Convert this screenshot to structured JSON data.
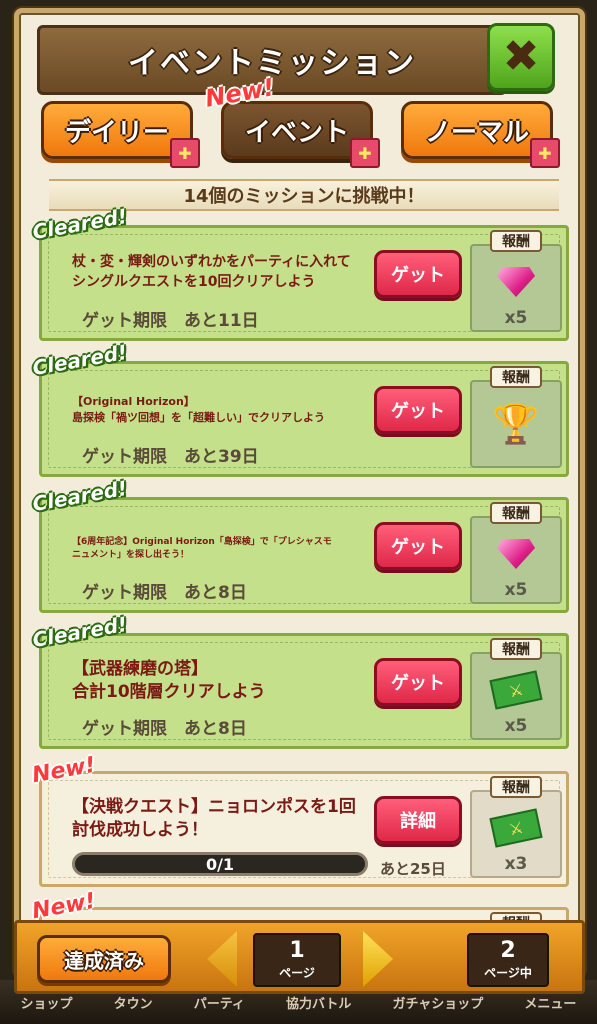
{
  "header": {
    "title": "イベントミッション",
    "close_icon": "close-x-icon"
  },
  "tabs": [
    {
      "label": "デイリー",
      "style": "orange"
    },
    {
      "label": "イベント",
      "style": "brown",
      "badge": "New!"
    },
    {
      "label": "ノーマル",
      "style": "orange"
    }
  ],
  "subtitle": "14個のミッションに挑戦中！",
  "missions": [
    {
      "status": "Cleared!",
      "desc": "杖・変・輝剣のいずれかをパーティに入れてシングルクエストを10回クリアしよう",
      "deadline": "ゲット期限　あと11日",
      "button": "ゲット",
      "reward_label": "報酬",
      "reward_icon": "gem-icon",
      "reward_qty": "x5"
    },
    {
      "status": "Cleared!",
      "desc": "【Original Horizon】\n島探検「禍ツ回想」を「超難しい」でクリアしよう",
      "deadline": "ゲット期限　あと39日",
      "button": "ゲット",
      "reward_label": "報酬",
      "reward_icon": "trophy-icon",
      "reward_qty": ""
    },
    {
      "status": "Cleared!",
      "desc": "【6周年記念】Original Horizon「島探検」で「プレシャスモニュメント」を探し出そう！",
      "deadline": "ゲット期限　あと8日",
      "button": "ゲット",
      "reward_label": "報酬",
      "reward_icon": "gem-icon",
      "reward_qty": "x5"
    },
    {
      "status": "Cleared!",
      "desc": "【武器練磨の塔】\n合計10階層クリアしよう",
      "deadline": "ゲット期限　あと8日",
      "button": "ゲット",
      "reward_label": "報酬",
      "reward_icon": "ticket-icon",
      "reward_qty": "x5"
    },
    {
      "status": "New!",
      "desc": "【決戦クエスト】ニョロンポスを1回討伐成功しよう！",
      "progress_text": "0/1",
      "progress": 0,
      "deadline": "あと25日",
      "button": "詳細",
      "reward_label": "報酬",
      "reward_icon": "ticket-icon",
      "reward_qty": "x3"
    }
  ],
  "partial_card": {
    "badge": "New!",
    "reward_label": "報酬"
  },
  "footer": {
    "done_button": "達成済み",
    "current_page": "1",
    "current_page_sub": "ページ",
    "total_pages": "2",
    "total_pages_sub": "ページ中"
  },
  "bottom_menu": [
    "ショップ",
    "タウン",
    "パーティ",
    "協力バトル",
    "ガチャショップ",
    "メニュー"
  ],
  "colors": {
    "accent_orange": "#f0780e",
    "cleared_green": "#c5e08a",
    "get_red": "#e02848"
  }
}
